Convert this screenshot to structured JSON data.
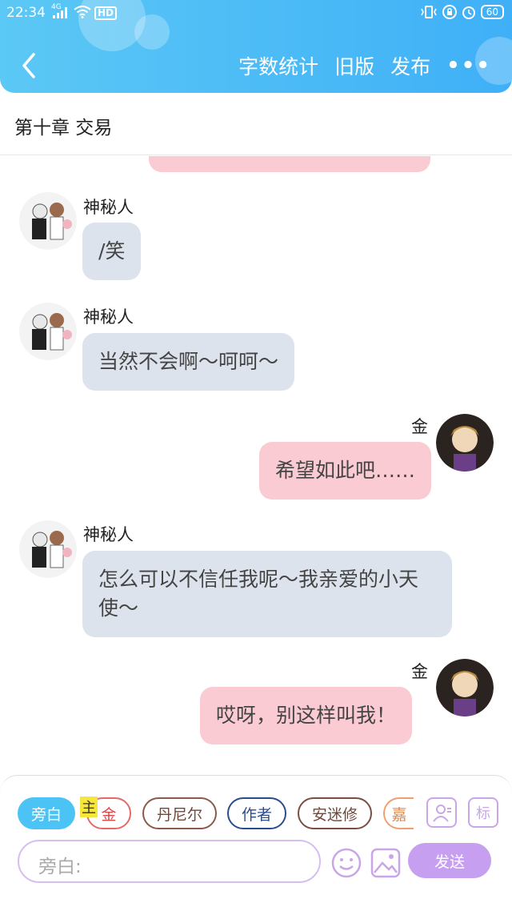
{
  "status_bar": {
    "time": "22:34",
    "signal_label": "4G",
    "hd_label": "HD",
    "battery": "60"
  },
  "nav": {
    "word_count": "字数统计",
    "old_version": "旧版",
    "publish": "发布",
    "more": "•••"
  },
  "chapter_title": "第十章 交易",
  "messages": [
    {
      "side": "left",
      "name": "神秘人",
      "text": "/笑"
    },
    {
      "side": "left",
      "name": "神秘人",
      "text": "当然不会啊～呵呵～"
    },
    {
      "side": "right",
      "name": "金",
      "text": "希望如此吧……"
    },
    {
      "side": "left",
      "name": "神秘人",
      "text": "怎么可以不信任我呢～我亲爱的小天使～"
    },
    {
      "side": "right",
      "name": "金",
      "text": "哎呀，别这样叫我！"
    }
  ],
  "roles": {
    "narration": "旁白",
    "main_tag": "主",
    "jin": "金",
    "daniel": "丹尼尔",
    "author": "作者",
    "anmixiu": "安迷修",
    "partial": "嘉",
    "mark_label": "标"
  },
  "composer": {
    "placeholder": "旁白:",
    "send": "发送"
  },
  "colors": {
    "header": "#3fb0f7",
    "left_bubble": "#dde3ec",
    "right_bubble": "#fbcbd4",
    "send_button": "#c69ff0"
  }
}
